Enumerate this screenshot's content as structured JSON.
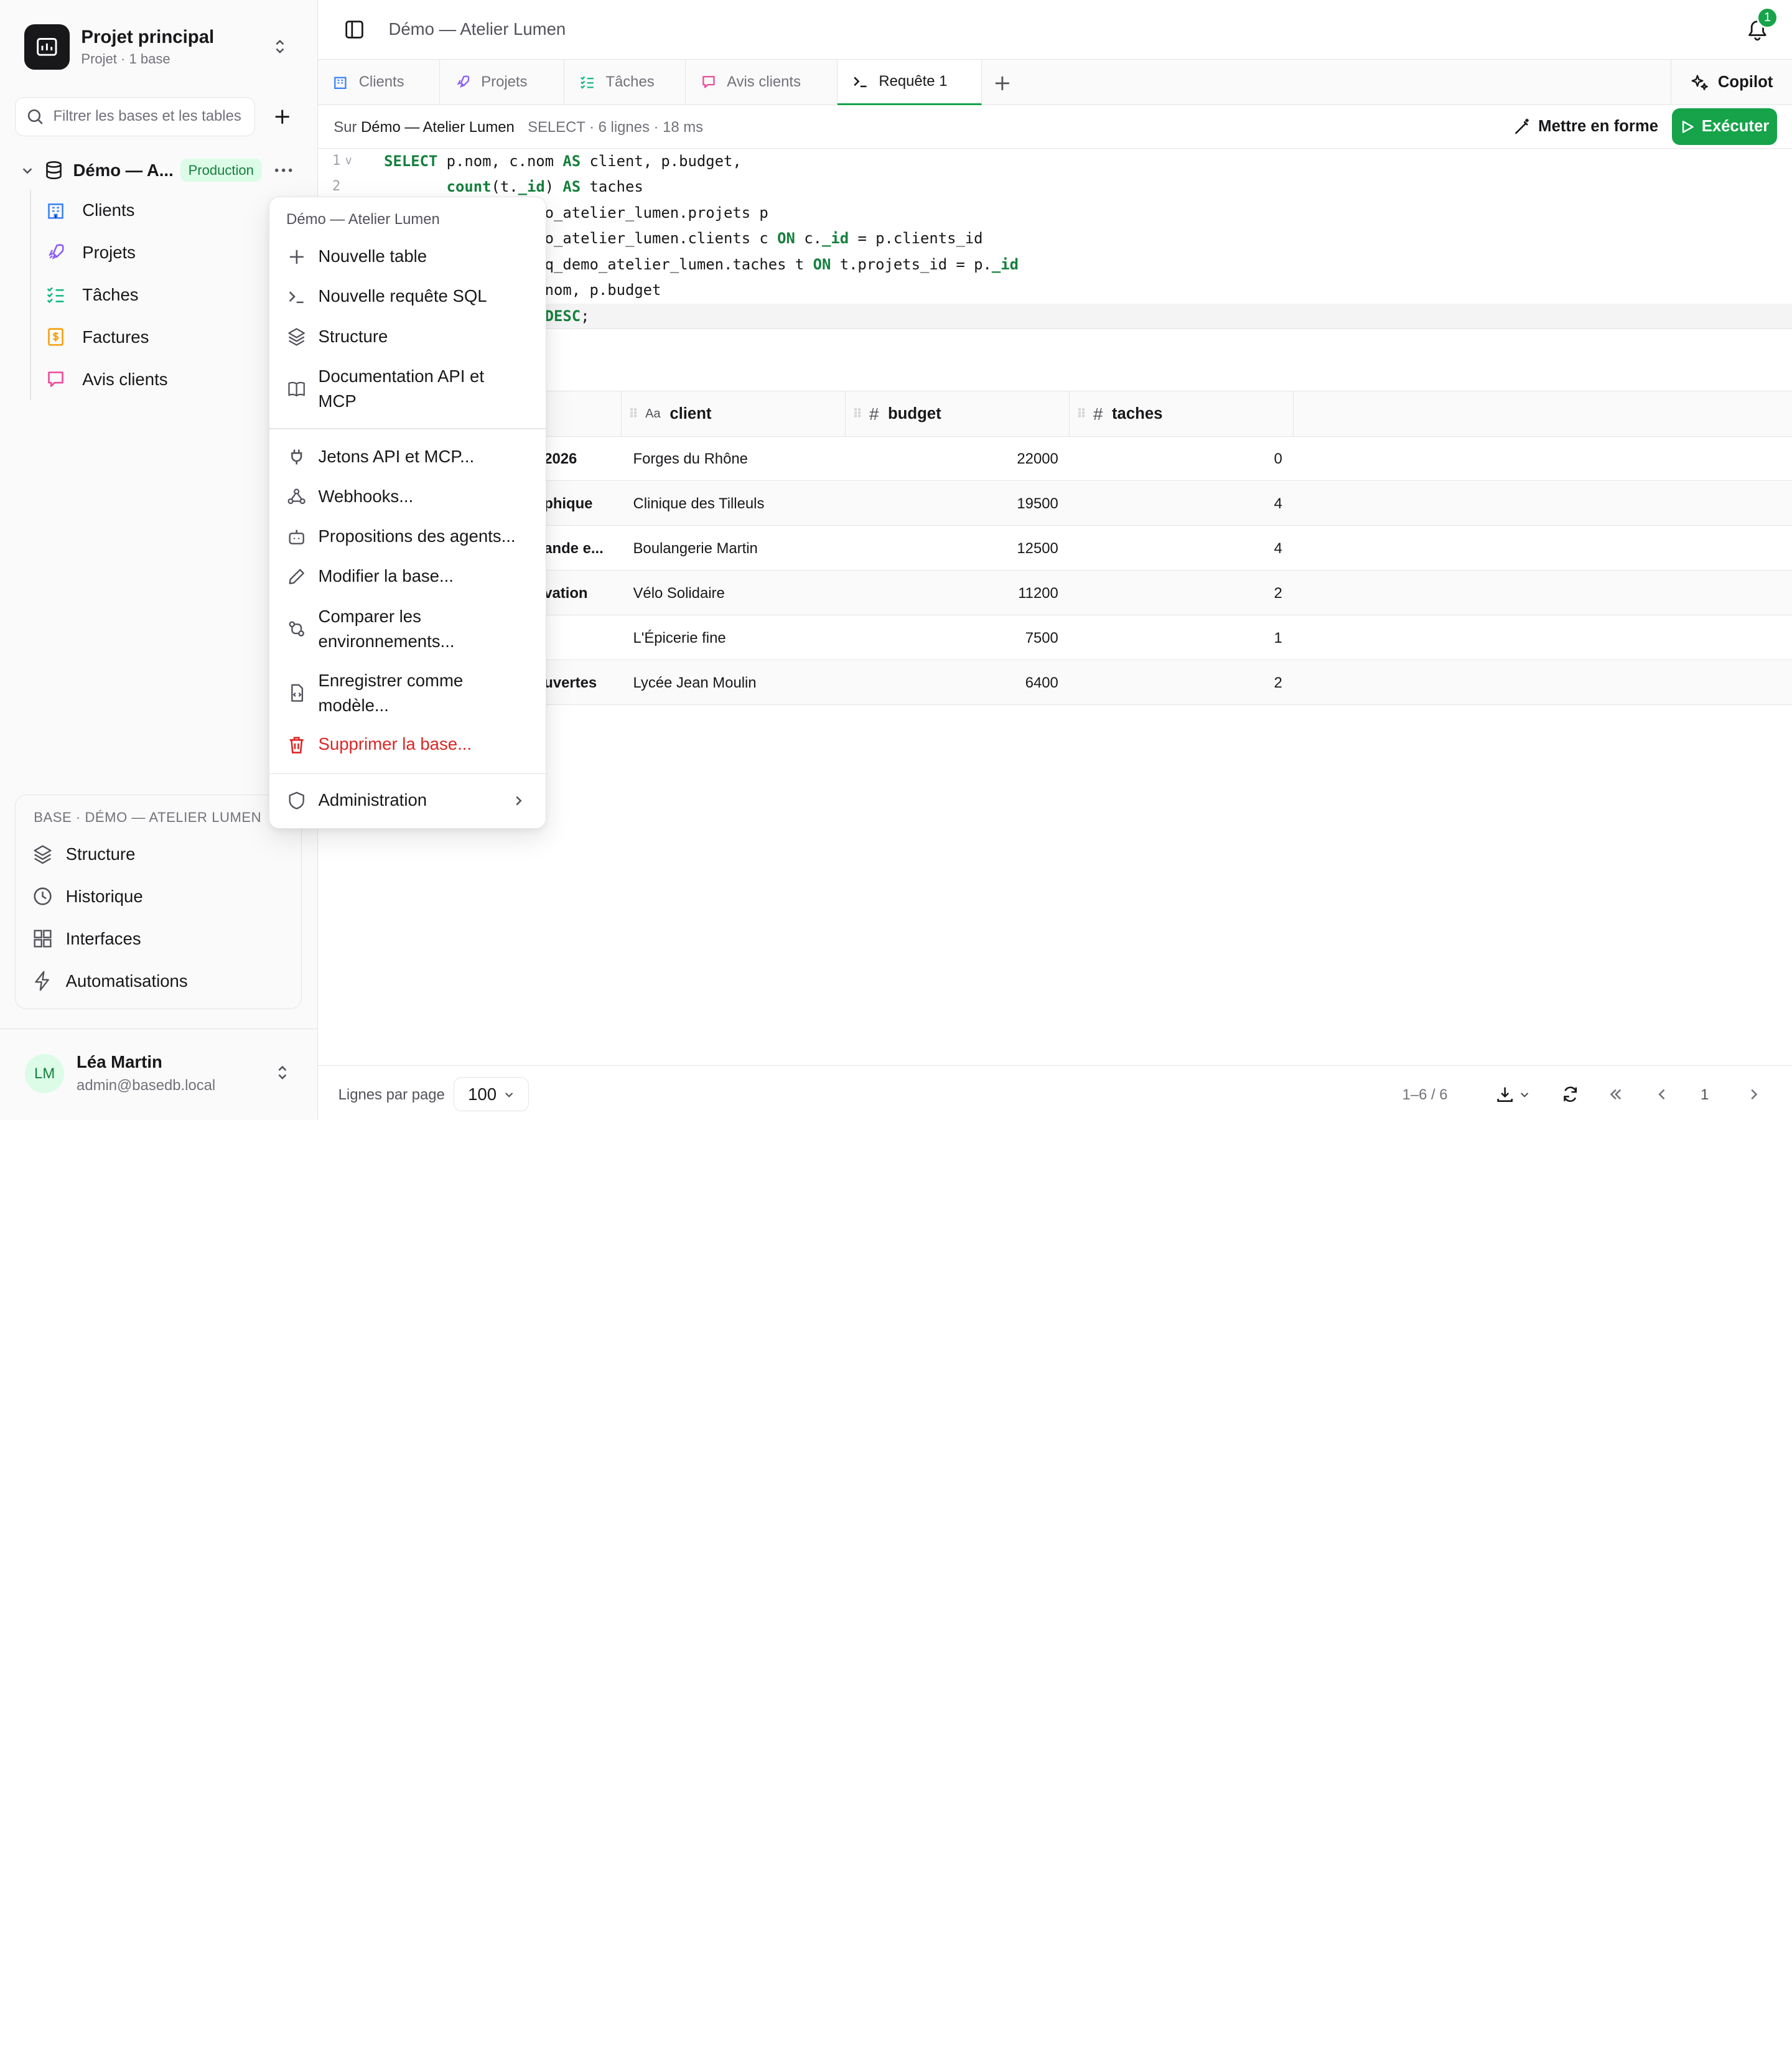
{
  "project": {
    "title": "Projet principal",
    "subtitle": "Projet · 1 base"
  },
  "filter": {
    "placeholder": "Filtrer les bases et les tables",
    "value": ""
  },
  "database": {
    "name": "Démo — A...",
    "badge": "Production"
  },
  "tables": [
    {
      "label": "Clients",
      "icon": "building-icon",
      "color": "#3b82f6"
    },
    {
      "label": "Projets",
      "icon": "rocket-icon",
      "color": "#8b5cf6"
    },
    {
      "label": "Tâches",
      "icon": "checklist-icon",
      "color": "#10b981"
    },
    {
      "label": "Factures",
      "icon": "invoice-icon",
      "color": "#f59e0b"
    },
    {
      "label": "Avis clients",
      "icon": "message-icon",
      "color": "#ec4899"
    }
  ],
  "base_section": {
    "label": "BASE · DÉMO — ATELIER LUMEN",
    "items": [
      {
        "label": "Structure",
        "icon": "layers-icon"
      },
      {
        "label": "Historique",
        "icon": "clock-icon"
      },
      {
        "label": "Interfaces",
        "icon": "grid-icon"
      },
      {
        "label": "Automatisations",
        "icon": "bolt-icon"
      }
    ]
  },
  "user": {
    "initials": "LM",
    "name": "Léa Martin",
    "email": "admin@basedb.local"
  },
  "header": {
    "breadcrumb": "Démo — Atelier Lumen",
    "notifications": "1"
  },
  "tabs": [
    {
      "label": "Clients",
      "icon": "building-icon"
    },
    {
      "label": "Projets",
      "icon": "rocket-icon"
    },
    {
      "label": "Tâches",
      "icon": "checklist-icon"
    },
    {
      "label": "Avis clients",
      "icon": "message-icon"
    },
    {
      "label": "Requête 1",
      "icon": "terminal-icon",
      "active": true
    }
  ],
  "copilot_label": "Copilot",
  "query": {
    "prefix": "Sur",
    "database": "Démo — Atelier Lumen",
    "meta": "SELECT · 6 lignes · 18 ms",
    "format_label": "Mettre en forme",
    "run_label": "Exécuter"
  },
  "code_lines": [
    {
      "n": "1",
      "fold": "v",
      "html": "<span class=\"kw\">SELECT</span> p.nom, c.nom <span class=\"kw\">AS</span> client, p.budget,"
    },
    {
      "n": "2",
      "fold": "",
      "html": "       <span class=\"kw\">count</span>(t.<span class=\"kw\">_id</span>) <span class=\"kw\">AS</span> taches"
    },
    {
      "n": "",
      "fold": "",
      "html": "                  o_atelier_lumen.projets p"
    },
    {
      "n": "",
      "fold": "",
      "html": "                  o_atelier_lumen.clients c <span class=\"kw\">ON</span> c.<span class=\"kw\">_id</span> = p.clients_id"
    },
    {
      "n": "",
      "fold": "",
      "html": "                  q_demo_atelier_lumen.taches t <span class=\"kw\">ON</span> t.projets_id = p.<span class=\"kw\">_id</span>"
    },
    {
      "n": "",
      "fold": "",
      "html": "                  nom, p.budget"
    },
    {
      "n": "",
      "fold": "",
      "html": "                  <span class=\"kw\">DESC</span>;",
      "current": true
    }
  ],
  "grid": {
    "columns": [
      {
        "name": "client",
        "type": "Aa"
      },
      {
        "name": "budget",
        "type": "#"
      },
      {
        "name": "taches",
        "type": "#"
      }
    ],
    "rows": [
      {
        "nom": "2026",
        "client": "Forges du Rhône",
        "budget": "22000",
        "taches": "0"
      },
      {
        "nom": "phique",
        "client": "Clinique des Tilleuls",
        "budget": "19500",
        "taches": "4"
      },
      {
        "nom": "ande e...",
        "client": "Boulangerie Martin",
        "budget": "12500",
        "taches": "4"
      },
      {
        "nom": "vation",
        "client": "Vélo Solidaire",
        "budget": "11200",
        "taches": "2"
      },
      {
        "nom": "",
        "client": "L'Épicerie fine",
        "budget": "7500",
        "taches": "1"
      },
      {
        "nom": "uvertes",
        "client": "Lycée Jean Moulin",
        "budget": "6400",
        "taches": "2"
      }
    ]
  },
  "footer": {
    "rows_per_page_label": "Lignes par page",
    "rows_per_page": "100",
    "range": "1–6 / 6",
    "page": "1"
  },
  "menu": {
    "header": "Démo — Atelier Lumen",
    "items": [
      {
        "label": "Nouvelle table",
        "icon": "plus-icon"
      },
      {
        "label": "Nouvelle requête SQL",
        "icon": "terminal-icon"
      },
      {
        "label": "Structure",
        "icon": "layers-icon"
      },
      {
        "label": "Documentation API et MCP",
        "icon": "book-icon"
      },
      {
        "label": "Jetons API et MCP...",
        "icon": "plug-icon"
      },
      {
        "label": "Webhooks...",
        "icon": "webhook-icon"
      },
      {
        "label": "Propositions des agents...",
        "icon": "bot-icon"
      },
      {
        "label": "Modifier la base...",
        "icon": "pencil-icon"
      },
      {
        "label": "Comparer les environnements...",
        "icon": "compare-icon"
      },
      {
        "label": "Enregistrer comme modèle...",
        "icon": "template-icon"
      },
      {
        "label": "Supprimer la base...",
        "icon": "trash-icon",
        "danger": true
      },
      {
        "label": "Administration",
        "icon": "shield-icon"
      }
    ]
  },
  "colors": {
    "accent": "#16a34a",
    "danger": "#dc2626",
    "badge_bg": "#dcfce7",
    "badge_text": "#15803d"
  }
}
